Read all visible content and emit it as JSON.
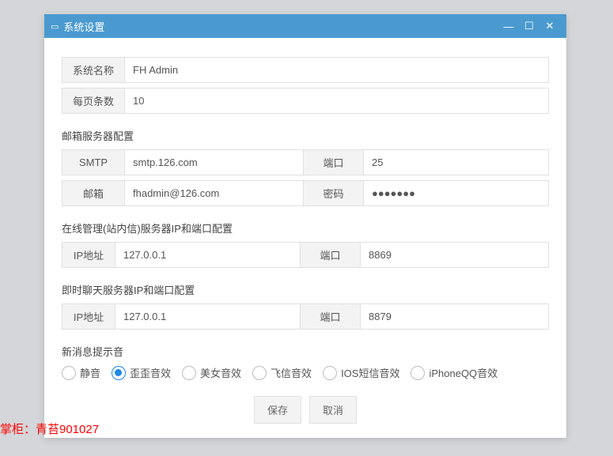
{
  "window": {
    "title": "系统设置"
  },
  "form": {
    "sysname_label": "系统名称",
    "sysname_value": "FH Admin",
    "pagesize_label": "每页条数",
    "pagesize_value": "10"
  },
  "sections": {
    "email_title": "邮箱服务器配置",
    "smtp_label": "SMTP",
    "smtp_value": "smtp.126.com",
    "port_label": "端口",
    "smtp_port_value": "25",
    "email_label": "邮箱",
    "email_value": "fhadmin@126.com",
    "pwd_label": "密码",
    "pwd_value": "●●●●●●●",
    "online_title": "在线管理(站内信)服务器IP和端口配置",
    "ip_label": "IP地址",
    "online_ip_value": "127.0.0.1",
    "online_port_value": "8869",
    "chat_title": "即时聊天服务器IP和端口配置",
    "chat_ip_value": "127.0.0.1",
    "chat_port_value": "8879",
    "sound_title": "新消息提示音"
  },
  "sounds": {
    "opt0": "静音",
    "opt1": "歪歪音效",
    "opt2": "美女音效",
    "opt3": "飞信音效",
    "opt4": "IOS短信音效",
    "opt5": "iPhoneQQ音效",
    "selected_index": 1
  },
  "buttons": {
    "save": "保存",
    "cancel": "取消"
  },
  "footer": "掌柜：青苔901027"
}
